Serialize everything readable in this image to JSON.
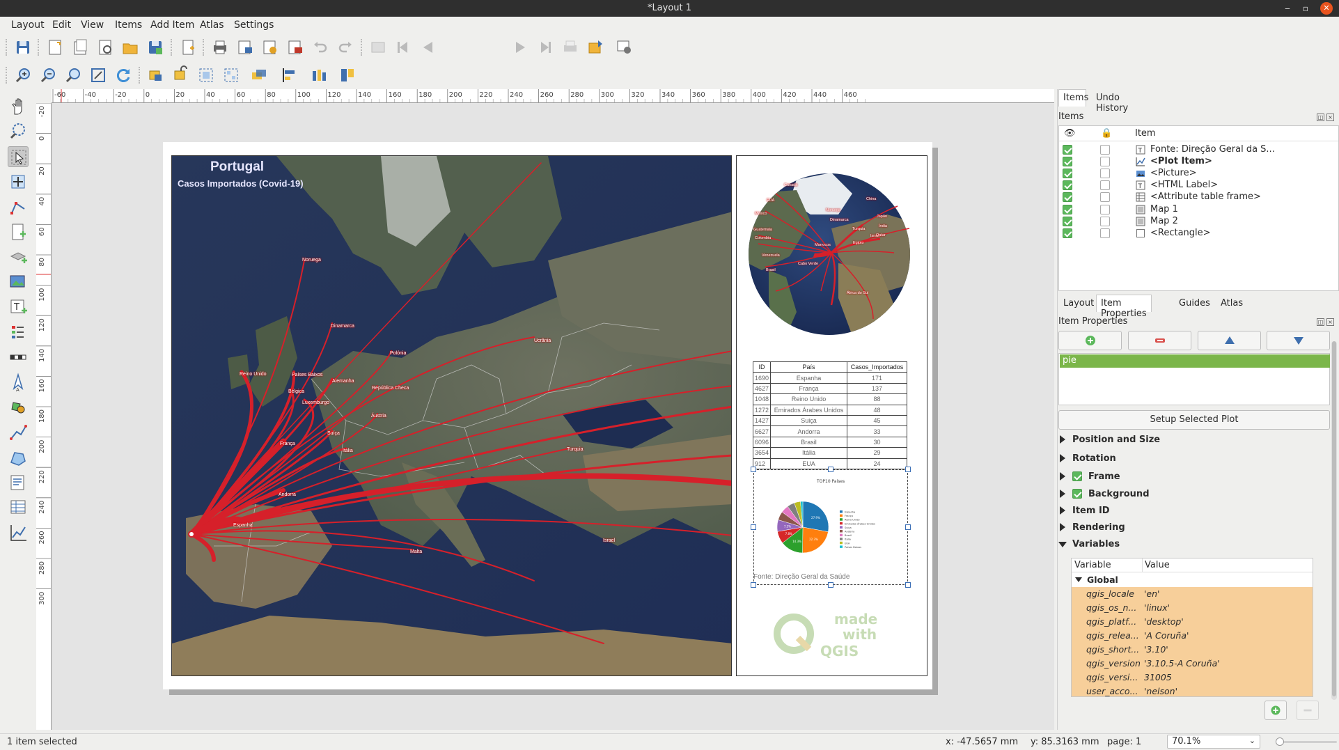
{
  "window": {
    "title": "*Layout 1"
  },
  "menu": [
    "Layout",
    "Edit",
    "View",
    "Items",
    "Add Item",
    "Atlas",
    "Settings"
  ],
  "toolbar": {
    "page_number": "1"
  },
  "map": {
    "title": "Portugal",
    "subtitle": "Casos Importados (Covid-19)",
    "place_labels": [
      "Noruega",
      "Dinamarca",
      "Polónia",
      "Ucrânia",
      "Reino Unido",
      "Países Baixos",
      "Alemanha",
      "Bélgica",
      "República Checa",
      "Luxemburgo",
      "Áustria",
      "Suíça",
      "França",
      "Itália",
      "Turquia",
      "Andorra",
      "Espanha",
      "Malta",
      "Israel"
    ]
  },
  "globe_labels": [
    "Canadá",
    "EUA",
    "México",
    "Guatemala",
    "Colombia",
    "Venezuela",
    "Brasil",
    "Cabo Verde",
    "Marrocos",
    "Noruega",
    "Dinamarca",
    "China",
    "Japão",
    "Turquia",
    "Egipto",
    "Israel",
    "Qatar",
    "Índia",
    "África do Sul"
  ],
  "attr_table": {
    "headers": [
      "ID",
      "País",
      "Casos_Importados"
    ],
    "rows": [
      [
        "1690",
        "Espanha",
        "171"
      ],
      [
        "4627",
        "França",
        "137"
      ],
      [
        "1048",
        "Reino Unido",
        "88"
      ],
      [
        "1272",
        "Emirados Árabes Unidos",
        "48"
      ],
      [
        "1427",
        "Suiça",
        "45"
      ],
      [
        "6627",
        "Andorra",
        "33"
      ],
      [
        "6096",
        "Brasil",
        "30"
      ],
      [
        "3654",
        "Itália",
        "29"
      ],
      [
        "912",
        "EUA",
        "24"
      ]
    ]
  },
  "pie_chart": {
    "title": "TOP10 Países",
    "legend": [
      "Espanha",
      "França",
      "Reino Unido",
      "Emirados Árabes Unidos",
      "Suiça",
      "Andorra",
      "Brasil",
      "Itália",
      "EUA",
      "Países Baixos"
    ],
    "slice_labels": [
      "27.9%",
      "22.3%",
      "14.3%",
      "7.8%",
      "7.3%"
    ],
    "colors": [
      "#1f77b4",
      "#ff7f0e",
      "#2ca02c",
      "#d62728",
      "#9467bd",
      "#8c564b",
      "#e377c2",
      "#7f7f7f",
      "#bcbd22",
      "#17becf"
    ]
  },
  "source_label": "Fonte: Direção Geral da Saúde",
  "logo_text": {
    "made": "made",
    "with": "with",
    "qgis": "QGIS"
  },
  "ruler_h": [
    "-60",
    "-40",
    "-20",
    "0",
    "20",
    "40",
    "60",
    "80",
    "100",
    "120",
    "140",
    "160",
    "180",
    "200",
    "220",
    "240",
    "260",
    "280",
    "300",
    "320",
    "340",
    "360",
    "380",
    "400",
    "420",
    "440",
    "460"
  ],
  "ruler_v": [
    "-20",
    "0",
    "20",
    "40",
    "60",
    "80",
    "100",
    "120",
    "140",
    "160",
    "180",
    "200",
    "220",
    "240",
    "260",
    "280",
    "300"
  ],
  "dock": {
    "top_tabs": [
      "Items",
      "Undo History"
    ],
    "items_panel_title": "Items",
    "items_header": "Item",
    "items": [
      {
        "name": "Fonte: Direção Geral da S...",
        "icon": "label-icon",
        "bold": false
      },
      {
        "name": "<Plot Item>",
        "icon": "plot-icon",
        "bold": true
      },
      {
        "name": "<Picture>",
        "icon": "picture-icon",
        "bold": false
      },
      {
        "name": "<HTML Label>",
        "icon": "label-icon",
        "bold": false
      },
      {
        "name": "<Attribute table frame>",
        "icon": "table-icon",
        "bold": false
      },
      {
        "name": "Map 1",
        "icon": "map-icon",
        "bold": false
      },
      {
        "name": "Map 2",
        "icon": "map-icon",
        "bold": false
      },
      {
        "name": "<Rectangle>",
        "icon": "rectangle-icon",
        "bold": false
      }
    ],
    "bottom_tabs": [
      "Layout",
      "Item Properties",
      "Guides",
      "Atlas"
    ],
    "props_title": "Item Properties",
    "plot_list_selected": "pie",
    "setup_button": "Setup Selected Plot",
    "sections": [
      "Position and Size",
      "Rotation",
      "Frame",
      "Background",
      "Item ID",
      "Rendering",
      "Variables"
    ],
    "var_headers": [
      "Variable",
      "Value"
    ],
    "var_group": "Global",
    "variables": [
      [
        "qgis_locale",
        "'en'"
      ],
      [
        "qgis_os_n...",
        "'linux'"
      ],
      [
        "qgis_platf...",
        "'desktop'"
      ],
      [
        "qgis_relea...",
        "'A Coruña'"
      ],
      [
        "qgis_short...",
        "'3.10'"
      ],
      [
        "qgis_version",
        "'3.10.5-A Coruña'"
      ],
      [
        "qgis_versi...",
        "31005"
      ],
      [
        "user_acco...",
        "'nelson'"
      ]
    ]
  },
  "status": {
    "selection": "1 item selected",
    "x": "x: -47.5657 mm",
    "y": "y: 85.3163 mm",
    "page": "page: 1",
    "zoom": "70.1%"
  }
}
